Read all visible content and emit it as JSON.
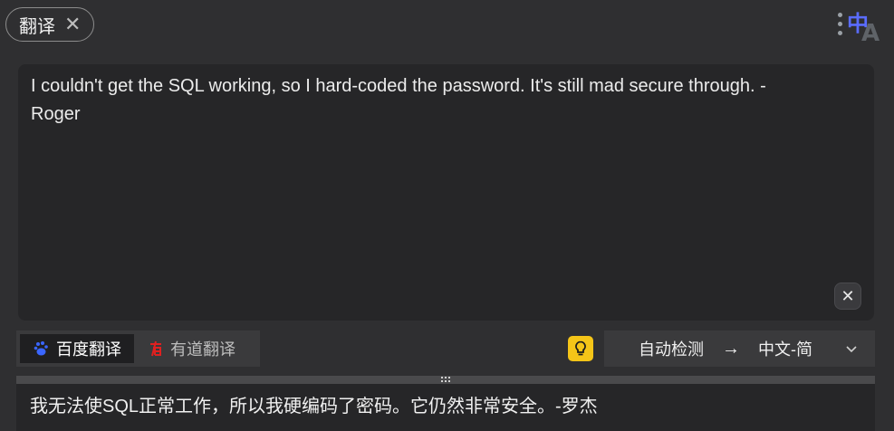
{
  "tag": {
    "label": "翻译",
    "close_symbol": "✕"
  },
  "logo": {
    "zh": "中",
    "a": "A"
  },
  "source": {
    "text": "I couldn't get the SQL working, so I hard-coded the password. It's still mad secure through. -\nRoger",
    "clear_symbol": "✕"
  },
  "engines": [
    {
      "label": "百度翻译",
      "icon": "baidu-paw-icon",
      "active": true
    },
    {
      "label": "有道翻译",
      "icon": "youdao-icon",
      "active": false
    }
  ],
  "language": {
    "from": "自动检测",
    "arrow": "→",
    "to": "中文-简",
    "chevron": "⌄"
  },
  "result": {
    "text": "我无法使SQL正常工作，所以我硬编码了密码。它仍然非常安全。-罗杰"
  },
  "colors": {
    "background": "#2f2f31",
    "panel": "#262628",
    "bulb": "#f5c518",
    "brand_blue": "#5a6cff",
    "baidu_blue": "#3a66ff",
    "youdao_red": "#e02020"
  }
}
